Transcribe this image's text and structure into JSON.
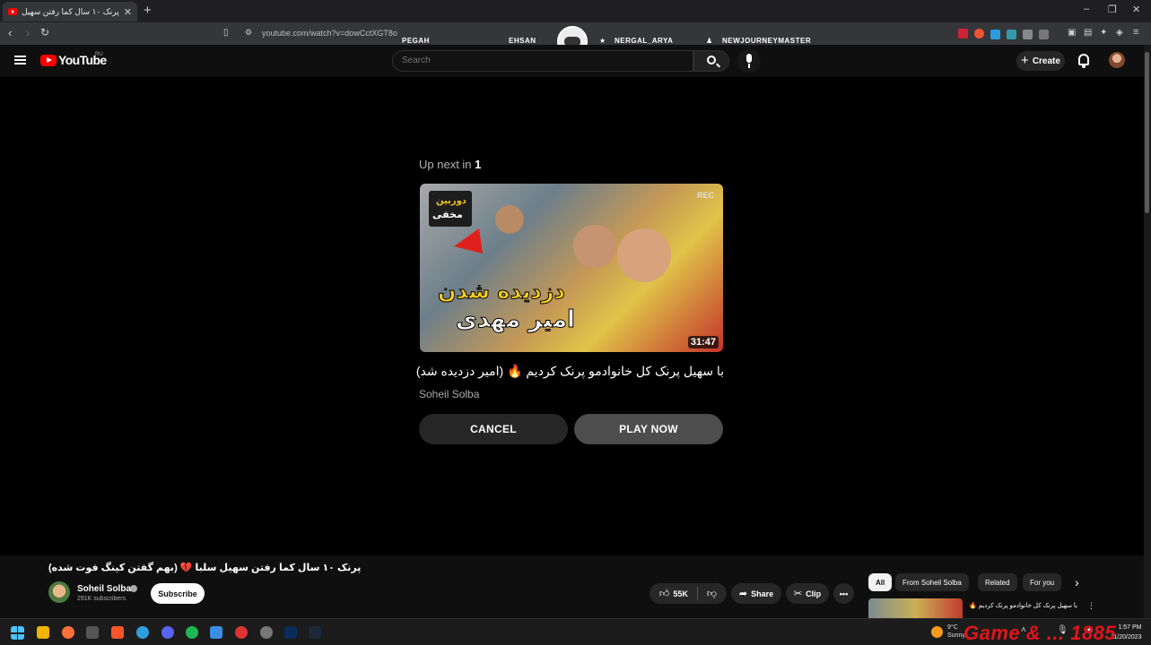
{
  "browser": {
    "tab_title": "پرنک ۱۰ سال کما رفتن سهیل سلبا 💔",
    "tab_close": "✕",
    "new_tab": "+",
    "window_controls": [
      "–",
      "❐",
      "✕"
    ],
    "url": "youtube.com/watch?v=dowCctXGT8o",
    "stream_overlay_names": [
      "PEGAH",
      "EHSAN",
      "NERGAL_ARYA",
      "NEWJOURNEYMASTER"
    ]
  },
  "youtube_header": {
    "logo_text": "YouTube",
    "country_code": "RU",
    "search_placeholder": "Search",
    "create_label": "Create"
  },
  "up_next": {
    "label_prefix": "Up next in ",
    "countdown": "1",
    "thumbnail_duration": "31:47",
    "thumbnail_badge": "REC",
    "video_title": "با سهیل پرنک کل خانوادمو پرنک کردیم 🔥 (امیر دزدیده شد)",
    "channel": "Soheil Solba",
    "cancel_label": "CANCEL",
    "play_label": "PLAY NOW"
  },
  "current_video": {
    "title": "پرنک ۱۰ سال کما رفتن سهیل سلبا 💔 (بهم گفتن کینگ فوت شده)",
    "channel_name": "Soheil Solba",
    "subscribers": "291K subscribers",
    "subscribe_label": "Subscribe",
    "likes": "55K",
    "share_label": "Share",
    "clip_label": "Clip",
    "more_label": "•••"
  },
  "side_panel": {
    "chips": [
      "All",
      "From Soheil Solba",
      "Related",
      "For you"
    ],
    "first_item_title": "با سهیل پرنک کل خانوادمو پرنک کردیم 🔥"
  },
  "taskbar": {
    "weather_temp": "9°C",
    "weather_desc": "Sunny",
    "time": "1:57 PM",
    "date": "11/20/2023",
    "watermark": "Game & ... 1885"
  },
  "colors": {
    "youtube_red": "#ff0000",
    "background": "#0f0f0f",
    "pill": "#272727",
    "play_now": "#4d4d4d"
  }
}
